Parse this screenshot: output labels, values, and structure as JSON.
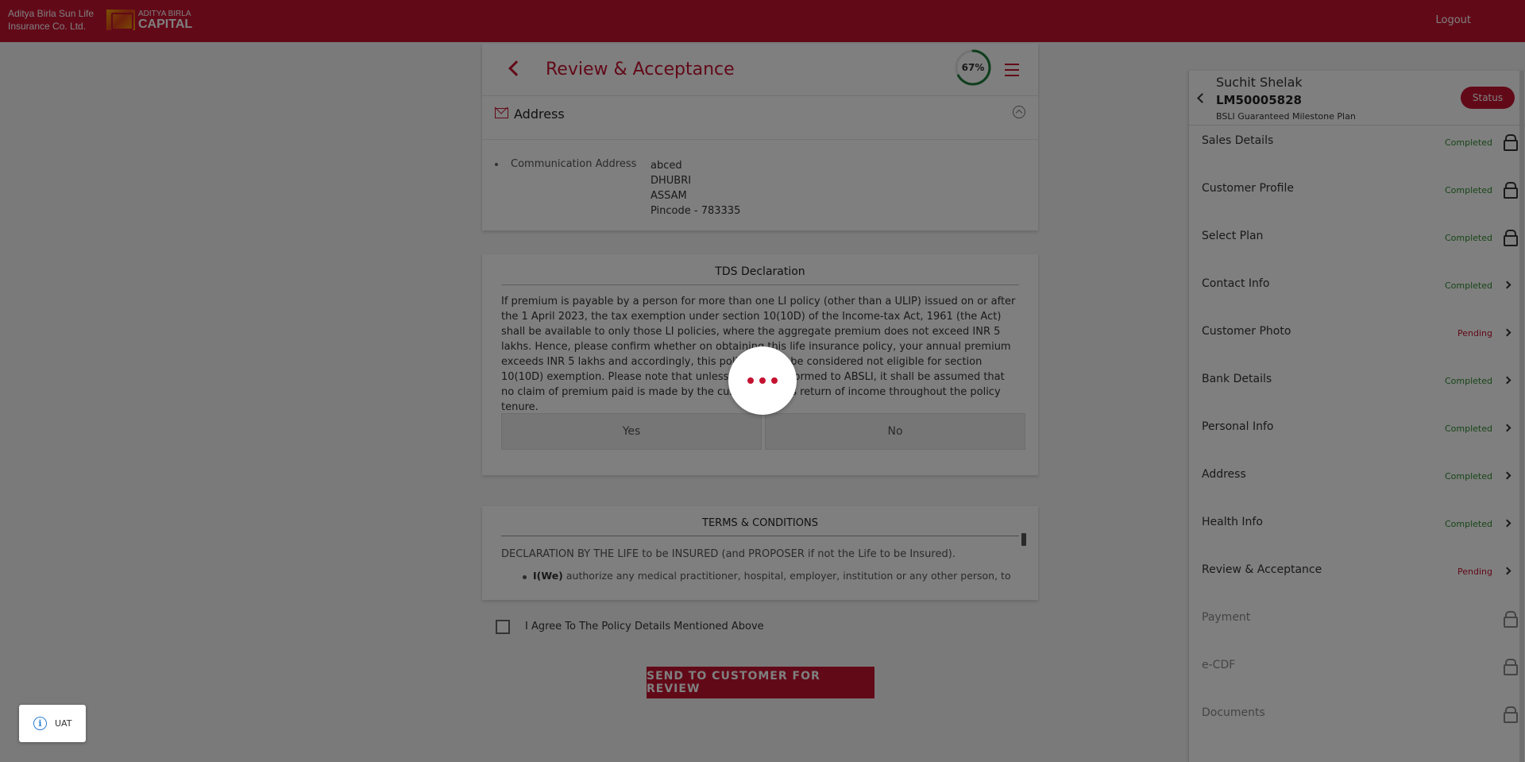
{
  "header": {
    "brand_line1": "Aditya Birla Sun Life",
    "brand_line2": "Insurance Co. Ltd.",
    "capital_top": "ADITYA BIRLA",
    "capital_bottom": "CAPITAL",
    "logout": "Logout"
  },
  "review": {
    "title": "Review & Acceptance",
    "progress_pct": 67,
    "progress_label": "67%"
  },
  "address": {
    "title": "Address",
    "label": "Communication Address",
    "lines": [
      "abced",
      "DHUBRI",
      "ASSAM",
      "Pincode - 783335"
    ]
  },
  "tds": {
    "title": "TDS Declaration",
    "text": "If premium is payable by a person for more than one LI policy (other than a ULIP) issued on or after the 1 April 2023, the tax exemption under section 10(10D) of the Income-tax Act, 1961 (the Act) shall be available to only those LI policies, where the aggregate premium does not exceed INR 5 lakhs. Hence, please confirm whether on obtaining this life insurance policy, your annual premium exceeds INR 5 lakhs and accordingly, this policy should be considered not eligible for section 10(10D) exemption. Please note that unless and until informed to ABSLI, it shall be assumed that no claim of premium paid is made by the customer in his return of income throughout the policy tenure.",
    "yes": "Yes",
    "no": "No"
  },
  "terms": {
    "title": "TERMS & CONDITIONS",
    "declaration": "DECLARATION BY THE LIFE to be INSURED (and PROPOSER if not the Life to be Insured).",
    "item_bold": "I(We)",
    "item_text": " authorize any medical practitioner, hospital, employer, institution or any other person, to"
  },
  "agree_label": "I Agree To The Policy Details Mentioned Above",
  "send_button": "SEND TO CUSTOMER FOR REVIEW",
  "uat_label": "UAT",
  "customer": {
    "name": "Suchit Shelak",
    "id": "LM50005828",
    "plan": "BSLI Guaranteed Milestone Plan",
    "status_button": "Status"
  },
  "steps": [
    {
      "label": "Sales Details",
      "status": "Completed",
      "icon": "lock-icon"
    },
    {
      "label": "Customer Profile",
      "status": "Completed",
      "icon": "lock-icon"
    },
    {
      "label": "Select Plan",
      "status": "Completed",
      "icon": "lock-icon"
    },
    {
      "label": "Contact Info",
      "status": "Completed",
      "icon": "chevron-right-icon"
    },
    {
      "label": "Customer Photo",
      "status": "Pending",
      "icon": "chevron-right-icon"
    },
    {
      "label": "Bank Details",
      "status": "Completed",
      "icon": "chevron-right-icon"
    },
    {
      "label": "Personal Info",
      "status": "Completed",
      "icon": "chevron-right-icon"
    },
    {
      "label": "Address",
      "status": "Completed",
      "icon": "chevron-right-icon"
    },
    {
      "label": "Health Info",
      "status": "Completed",
      "icon": "chevron-right-icon"
    },
    {
      "label": "Review & Acceptance",
      "status": "Pending",
      "icon": "chevron-right-icon"
    },
    {
      "label": "Payment",
      "status": "",
      "icon": "lock-icon"
    },
    {
      "label": "e-CDF",
      "status": "",
      "icon": "lock-icon"
    },
    {
      "label": "Documents",
      "status": "",
      "icon": "lock-icon"
    }
  ],
  "colors": {
    "brand_red": "#c41230",
    "completed": "#2e8b2e",
    "progress_green": "#1e7d3a"
  }
}
